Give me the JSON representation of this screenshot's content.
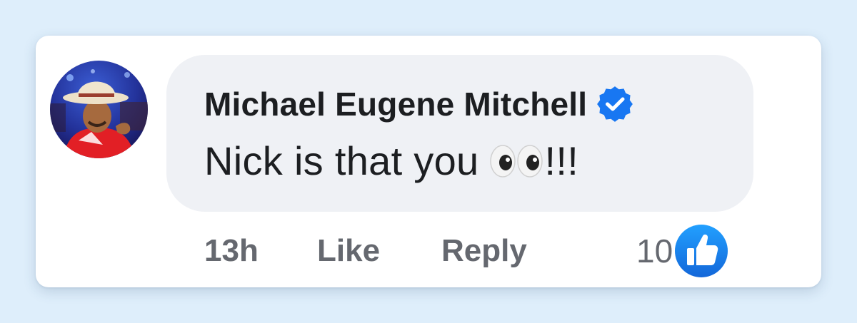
{
  "comment": {
    "author": "Michael Eugene Mitchell",
    "text": "Nick is that you",
    "text_suffix": "!!!",
    "emoji_icon": "eyes-emoji-icon",
    "time": "13h",
    "like_label": "Like",
    "reply_label": "Reply",
    "reaction_count": "10",
    "reaction_icon": "thumbs-up-icon"
  },
  "colors": {
    "page_background": "#deeefb",
    "card_background": "#ffffff",
    "bubble_background": "#eff1f5",
    "text_primary": "#1c1e21",
    "text_secondary": "#65686f",
    "brand_blue": "#1877f2"
  }
}
